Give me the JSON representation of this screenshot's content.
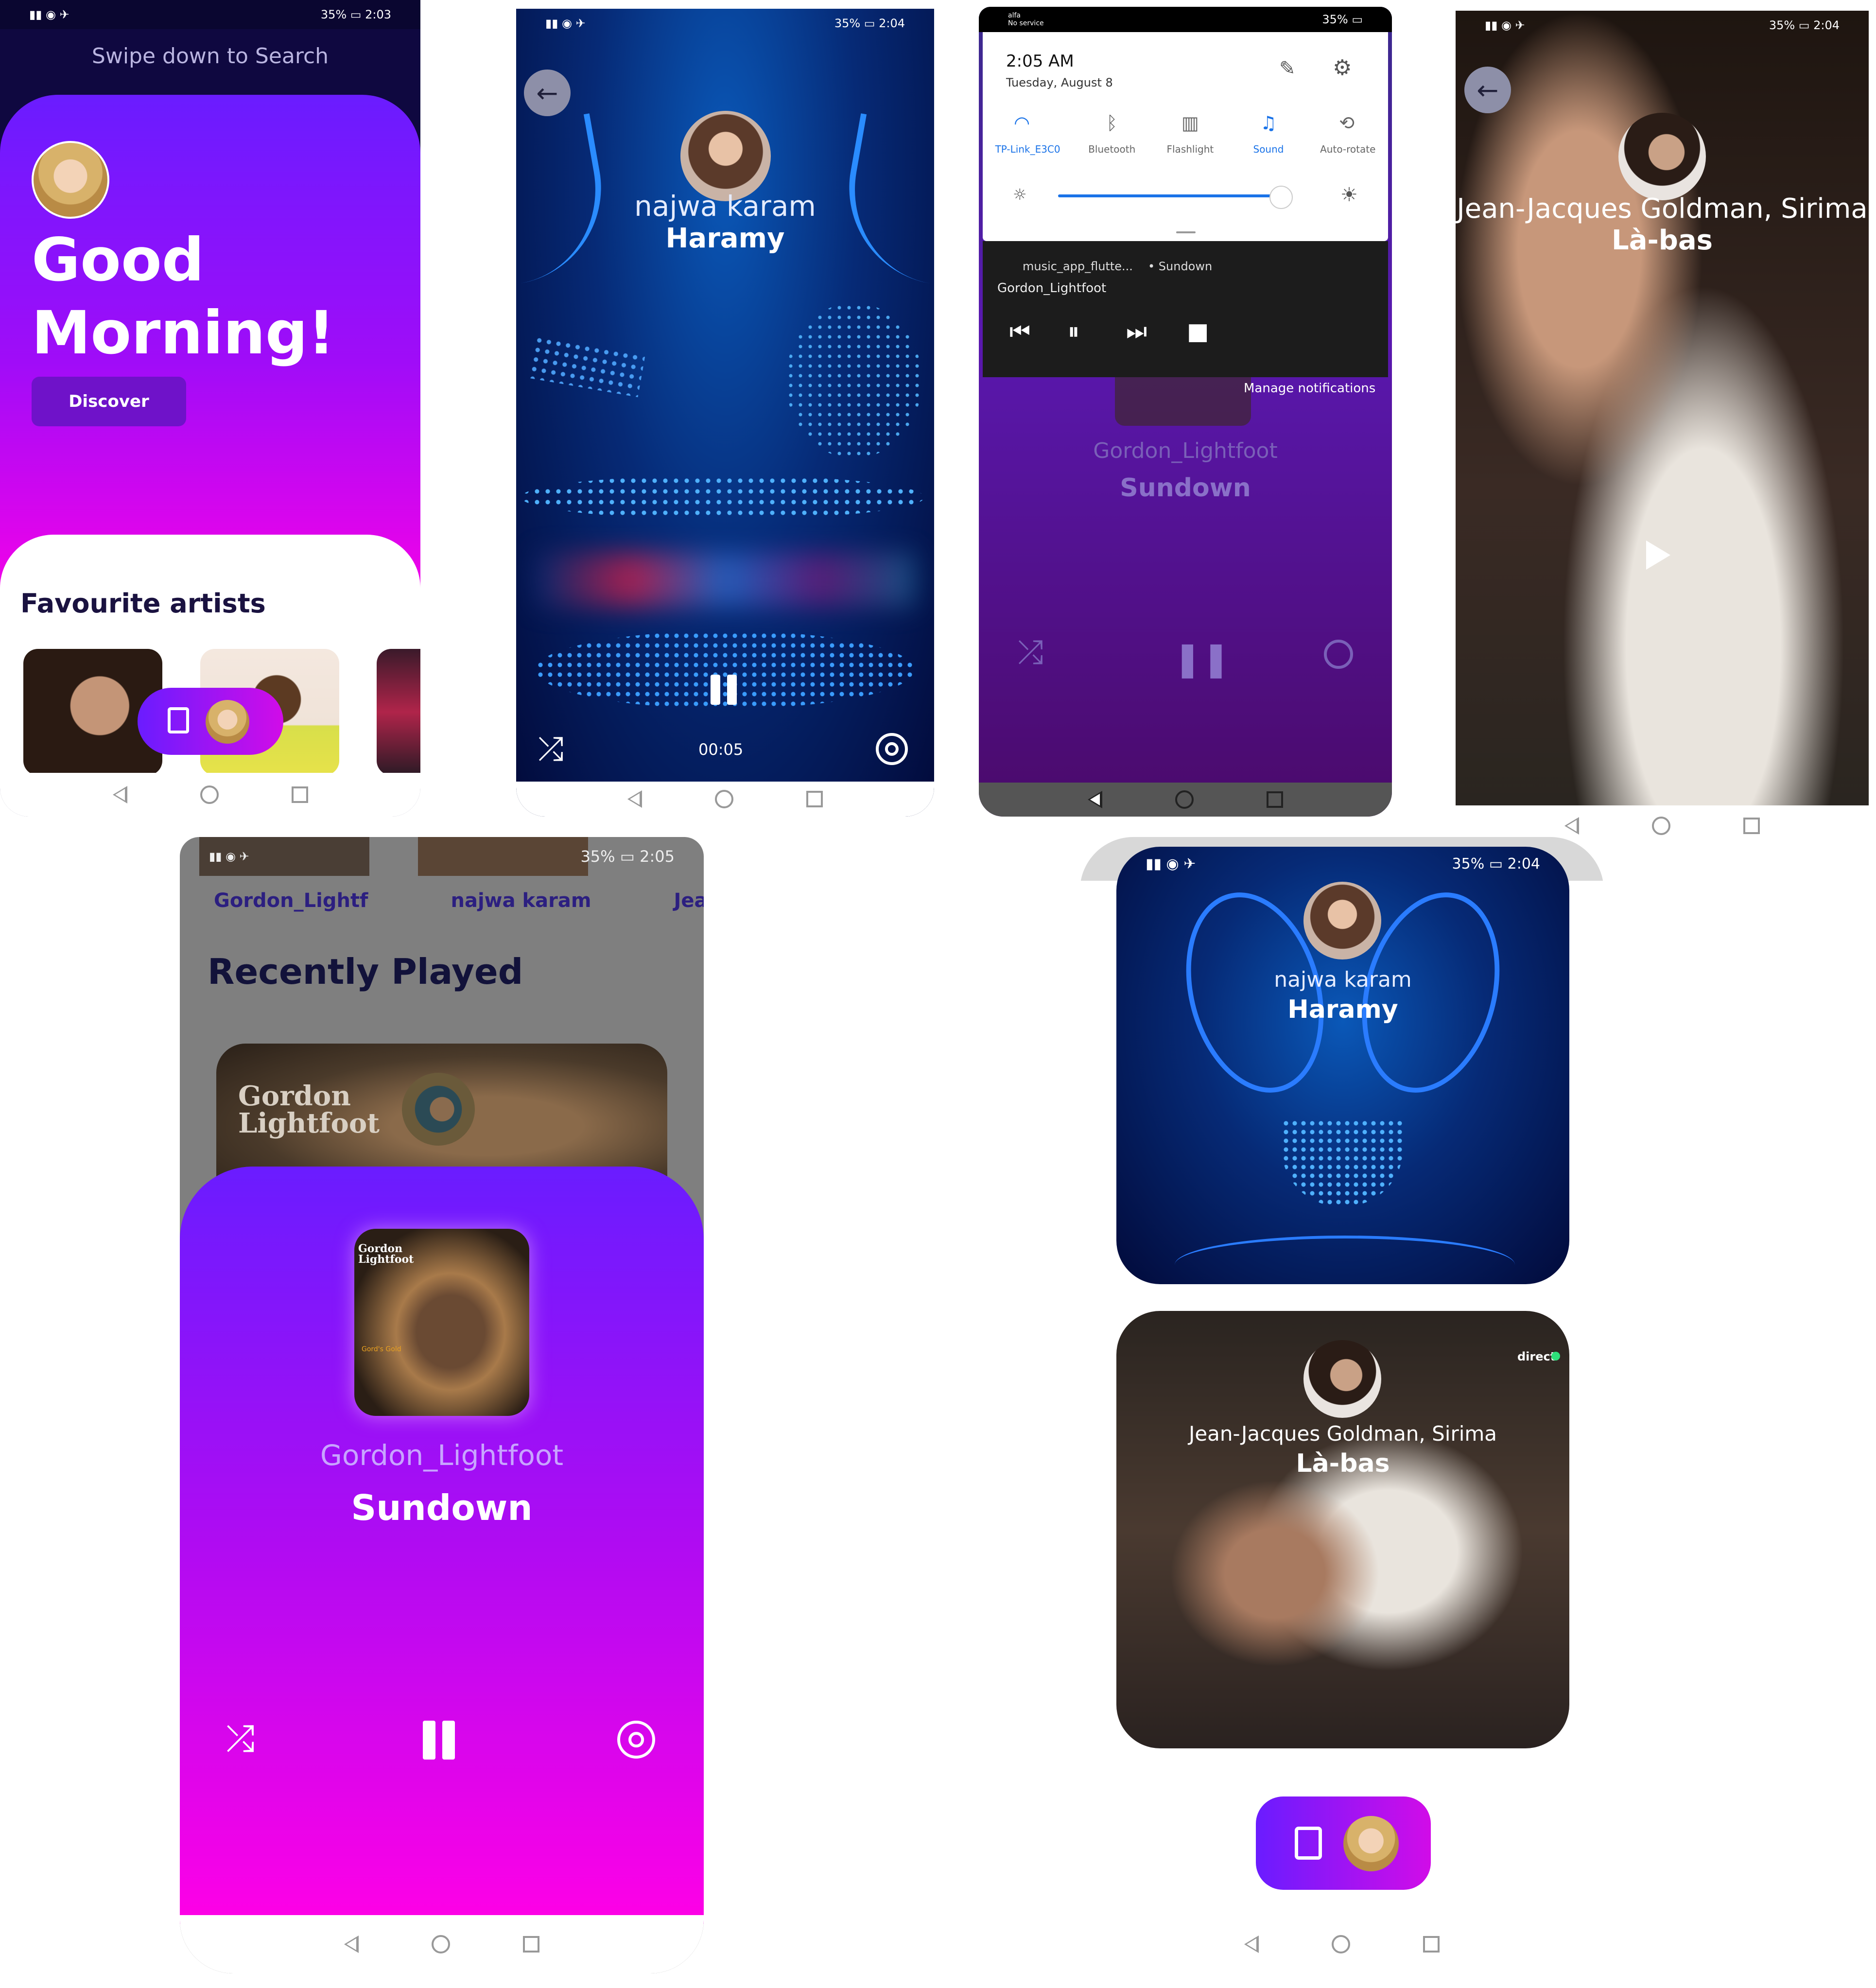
{
  "status": {
    "battery": "35%",
    "time_1": "2:03",
    "time_2": "2:04",
    "time_3": "2:04",
    "time_4": "2:05",
    "time_5": "2:04",
    "no_service_1": "alfa",
    "no_service_2": "No service"
  },
  "home": {
    "hint": "Swipe down to Search",
    "greeting_line1": "Good",
    "greeting_line2": "Morning!",
    "discover_label": "Discover",
    "favourites_title": "Favourite artists"
  },
  "player_najwa": {
    "artist": "najwa karam",
    "song": "Haramy",
    "elapsed": "00:05"
  },
  "notification": {
    "time": "2:05 AM",
    "date": "Tuesday, August 8",
    "tiles": [
      {
        "icon": "wifi-icon",
        "label": "TP-Link_E3C0",
        "active": true
      },
      {
        "icon": "bluetooth-icon",
        "label": "Bluetooth",
        "active": false
      },
      {
        "icon": "flashlight-icon",
        "label": "Flashlight",
        "active": false
      },
      {
        "icon": "bell-icon",
        "label": "Sound",
        "active": true
      },
      {
        "icon": "auto-rotate-icon",
        "label": "Auto-rotate",
        "active": false
      }
    ],
    "app_name": "music_app_flutte...",
    "app_song": "• Sundown",
    "app_artist": "Gordon_Lightfoot",
    "manage": "Manage notifications",
    "behind_artist": "Gordon_Lightfoot",
    "behind_song": "Sundown",
    "accent": "#1a73e8"
  },
  "player_jj": {
    "artist": "Jean-Jacques Goldman, Sirima",
    "song": "Là-bas"
  },
  "recent": {
    "tabs": [
      "Gordon_Lightf",
      "najwa karam",
      "Jean-"
    ],
    "title": "Recently Played",
    "album_text_line1": "Gordon",
    "album_text_line2": "Lightfoot",
    "cover_text_line1": "Gordon",
    "cover_text_line2": "Lightfoot",
    "cover_small": "Gord's Gold",
    "artist": "Gordon_Lightfoot",
    "song": "Sundown"
  },
  "cards": {
    "card1_artist": "najwa karam",
    "card1_song": "Haramy",
    "card2_artist": "Jean-Jacques Goldman, Sirima",
    "card2_song": "Là-bas",
    "direct": "direct"
  },
  "colors": {
    "purple_top": "#6a1cff",
    "magenta": "#ff00e6",
    "deep_navy": "#020a3a"
  }
}
